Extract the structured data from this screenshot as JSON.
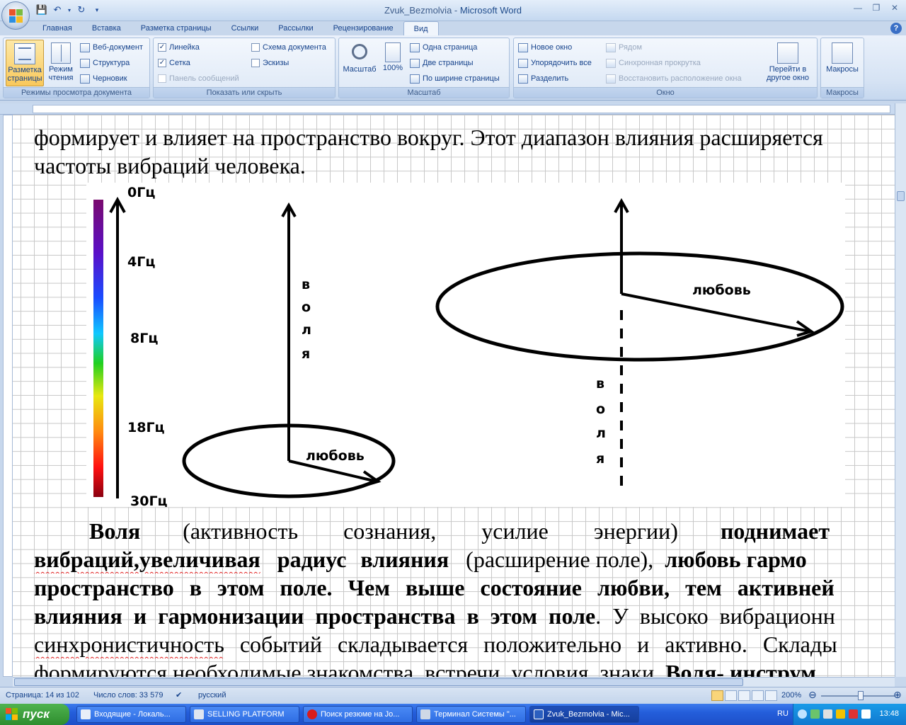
{
  "window": {
    "title": "Zvuk_Bezmolvia",
    "app": "Microsoft Word"
  },
  "tabs": [
    "Главная",
    "Вставка",
    "Разметка страницы",
    "Ссылки",
    "Рассылки",
    "Рецензирование",
    "Вид"
  ],
  "active_tab": "Вид",
  "ribbon": {
    "views": {
      "label": "Режимы просмотра документа",
      "page_layout": "Разметка страницы",
      "reading": "Режим чтения",
      "web": "Веб-документ",
      "structure": "Структура",
      "draft": "Черновик"
    },
    "show_hide": {
      "label": "Показать или скрыть",
      "ruler": "Линейка",
      "grid": "Сетка",
      "message_bar": "Панель сообщений",
      "doc_map": "Схема документа",
      "thumbnails": "Эскизы",
      "ruler_checked": true,
      "grid_checked": true
    },
    "zoom": {
      "label": "Масштаб",
      "zoom": "Масштаб",
      "hundred": "100%",
      "one_page": "Одна страница",
      "two_pages": "Две страницы",
      "page_width": "По ширине страницы"
    },
    "window": {
      "label": "Окно",
      "new_window": "Новое окно",
      "arrange_all": "Упорядочить все",
      "split": "Разделить",
      "side_by_side": "Рядом",
      "sync_scroll": "Синхронная прокрутка",
      "reset_position": "Восстановить расположение окна",
      "switch_window": "Перейти в другое окно"
    },
    "macros": {
      "label": "Макросы",
      "macros": "Макросы"
    }
  },
  "document": {
    "line1": "формирует и влияет на пространство вокруг. Этот диапазон влияния расширяется",
    "line2": "частоты вибраций человека.",
    "para": {
      "l1_a": "Воля",
      "l1_b": "(активность сознания, усилие энергии)",
      "l1_c": "поднимает",
      "l2_a": "вибраций,увеличивая",
      "l2_b": "радиус влияния",
      "l2_c": "(расширение поле),",
      "l2_d": "любовь гармо",
      "l3": "пространство в этом поле. Чем выше состояние любви, тем активней",
      "l4_a": "влияния и гармонизации пространства в этом поле",
      "l4_b": ". У высоко вибрационн",
      "l5_a": "синхронистичность",
      "l5_b": " событий складывается положительно и активно. Склады",
      "l6_a": "формируются необходимые знакомства, встречи, условия, знаки.",
      "l6_b": " Воля- инструм"
    },
    "figure": {
      "freq_labels": [
        "0Гц",
        "4Гц",
        "8Гц",
        "18Гц",
        "30Гц"
      ],
      "volya_letters": [
        "в",
        "о",
        "л",
        "я"
      ],
      "love_label": "любовь"
    }
  },
  "status": {
    "page": "Страница: 14 из 102",
    "words": "Число слов: 33 579",
    "language": "русский",
    "zoom": "200%"
  },
  "taskbar": {
    "start": "пуск",
    "tasks": [
      "Входящие - Локаль...",
      "SELLING PLATFORM",
      "Поиск резюме на Jo...",
      "Терминал Системы \"...",
      "Zvuk_Bezmolvia - Mic..."
    ],
    "lang": "RU",
    "clock": "13:48"
  }
}
